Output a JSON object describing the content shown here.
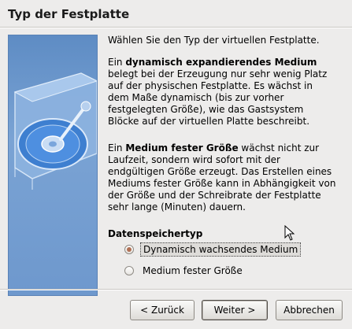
{
  "header": {
    "title": "Typ der Festplatte"
  },
  "content": {
    "intro": "Wählen Sie den Typ der virtuellen Festplatte.",
    "dynamic_desc": {
      "prefix": "Ein ",
      "bold": "dynamisch expandierendes Medium",
      "rest": " belegt bei der Erzeugung nur sehr wenig Platz auf der physischen Festplatte. Es wächst in dem Maße dynamisch (bis zur vorher festgelegten Größe), wie das Gastsystem Blöcke auf der virtuellen Platte beschreibt."
    },
    "fixed_desc": {
      "prefix": "Ein ",
      "bold": "Medium fester Größe",
      "rest": " wächst nicht zur Laufzeit, sondern wird sofort mit der endgültigen Größe erzeugt. Das Erstellen eines Mediums fester Größe kann in Abhängigkeit von der Größe und der Schreibrate der Festplatte sehr lange (Minuten) dauern."
    },
    "storage_type": {
      "label": "Datenspeichertyp",
      "options": [
        {
          "label": "Dynamisch wachsendes Medium",
          "selected": true
        },
        {
          "label": "Medium fester Größe",
          "selected": false
        }
      ]
    }
  },
  "buttons": {
    "back": "< Zurück",
    "next": "Weiter >",
    "cancel": "Abbrechen"
  },
  "colors": {
    "window_bg": "#edeceb",
    "illustration_bg": "#6e98cd",
    "radio_dot": "#b07054"
  },
  "icons": [
    "hard-disk-illustration",
    "mouse-pointer-icon"
  ]
}
